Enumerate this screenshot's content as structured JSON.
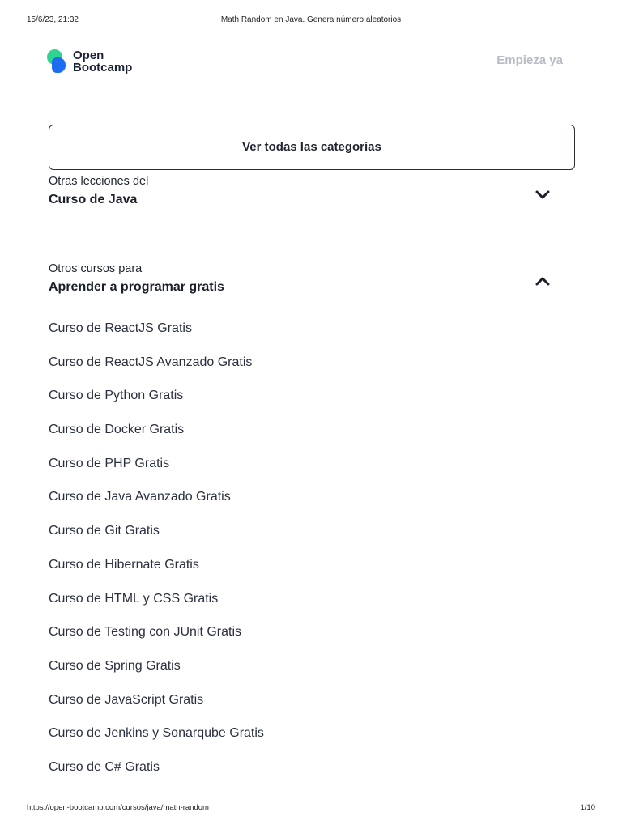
{
  "print": {
    "datetime": "15/6/23, 21:32",
    "page_title": "Math Random en Java. Genera número aleatorios",
    "url": "https://open-bootcamp.com/cursos/java/math-random",
    "page_count": "1/10"
  },
  "brand": {
    "line1": "Open",
    "line2": "Bootcamp",
    "colors": {
      "green": "#2ed48f",
      "blue": "#1d6df2"
    }
  },
  "nav": {
    "start_label": "Empieza ya"
  },
  "categories_button": "Ver todas las categorías",
  "lessons_section": {
    "pre": "Otras lecciones del",
    "title": "Curso de Java",
    "icon": "chevron-down-icon"
  },
  "courses_section": {
    "pre": "Otros cursos para",
    "title": "Aprender a programar gratis",
    "icon": "chevron-up-icon",
    "items": [
      "Curso de ReactJS Gratis",
      "Curso de ReactJS Avanzado Gratis",
      "Curso de Python Gratis",
      "Curso de Docker Gratis",
      "Curso de PHP Gratis",
      "Curso de Java Avanzado Gratis",
      "Curso de Git Gratis",
      "Curso de Hibernate Gratis",
      "Curso de HTML y CSS Gratis",
      "Curso de Testing con JUnit Gratis",
      "Curso de Spring Gratis",
      "Curso de JavaScript Gratis",
      "Curso de Jenkins y Sonarqube Gratis",
      "Curso de C# Gratis"
    ]
  }
}
